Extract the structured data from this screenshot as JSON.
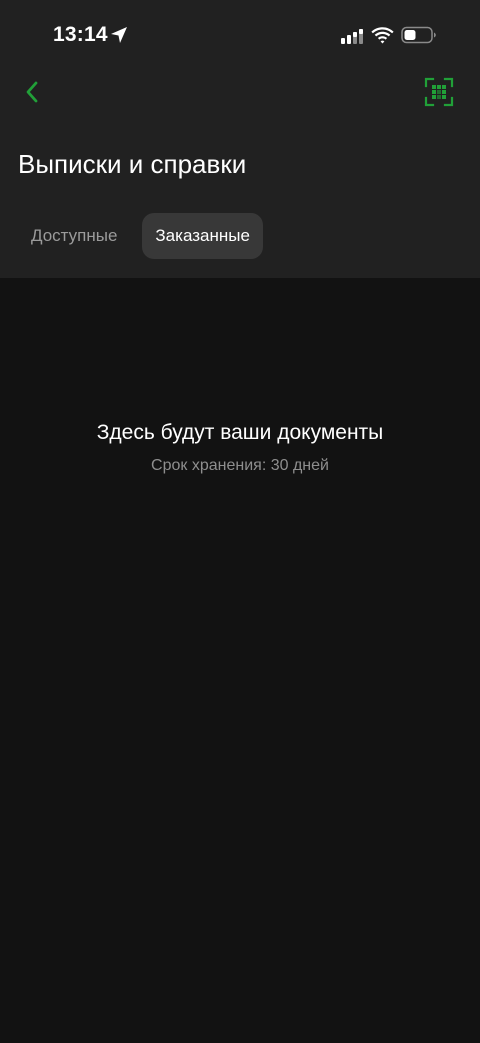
{
  "status_bar": {
    "time": "13:14",
    "icons": [
      "location-arrow-icon",
      "signal-icon",
      "wifi-icon",
      "battery-icon"
    ]
  },
  "nav": {
    "back_icon": "chevron-left-icon",
    "qr_icon": "qr-scan-icon"
  },
  "page": {
    "title": "Выписки и справки"
  },
  "tabs": [
    {
      "label": "Доступные",
      "active": false
    },
    {
      "label": "Заказанные",
      "active": true
    }
  ],
  "empty_state": {
    "title": "Здесь будут ваши документы",
    "subtitle": "Срок хранения: 30 дней"
  },
  "colors": {
    "accent": "#21a038",
    "header_bg": "#212121",
    "body_bg": "#121212",
    "tab_active_bg": "#383838"
  }
}
